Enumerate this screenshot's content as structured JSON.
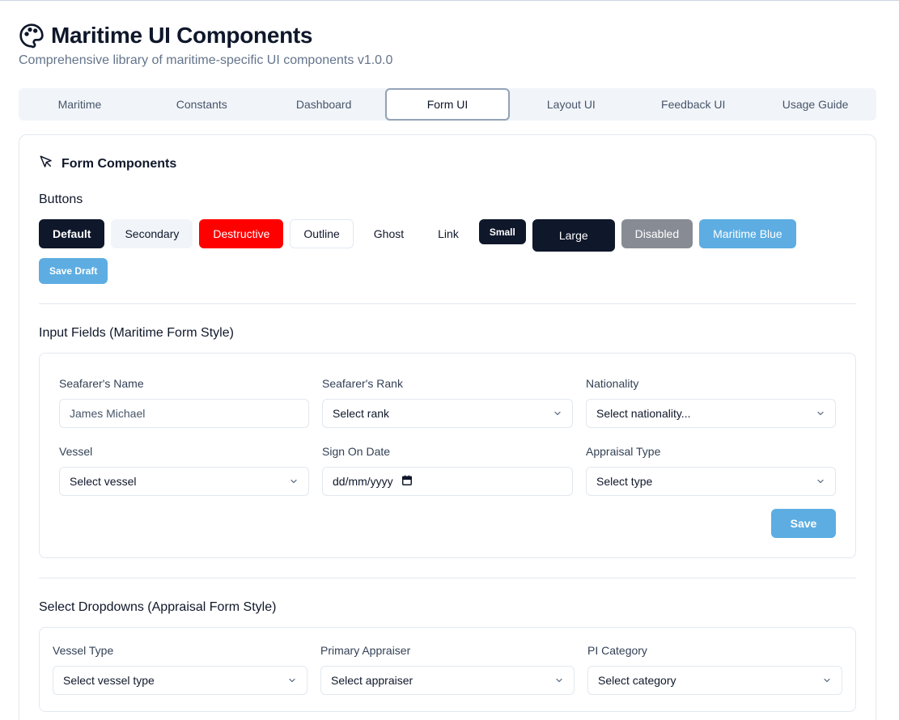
{
  "header": {
    "title": "Maritime UI Components",
    "subtitle": "Comprehensive library of maritime-specific UI components v1.0.0"
  },
  "tabs": [
    {
      "label": "Maritime"
    },
    {
      "label": "Constants"
    },
    {
      "label": "Dashboard"
    },
    {
      "label": "Form UI",
      "active": true
    },
    {
      "label": "Layout UI"
    },
    {
      "label": "Feedback UI"
    },
    {
      "label": "Usage Guide"
    }
  ],
  "card": {
    "title": "Form Components",
    "buttons_heading": "Buttons",
    "buttons": {
      "default": "Default",
      "secondary": "Secondary",
      "destructive": "Destructive",
      "outline": "Outline",
      "ghost": "Ghost",
      "link": "Link",
      "small": "Small",
      "large": "Large",
      "disabled": "Disabled",
      "maritime": "Maritime Blue",
      "save_draft": "Save Draft"
    },
    "inputs_heading": "Input Fields (Maritime Form Style)",
    "inputs": {
      "name_label": "Seafarer's Name",
      "name_placeholder": "James Michael",
      "rank_label": "Seafarer's Rank",
      "rank_value": "Select rank",
      "nationality_label": "Nationality",
      "nationality_value": "Select nationality...",
      "vessel_label": "Vessel",
      "vessel_value": "Select vessel",
      "signon_label": "Sign On Date",
      "signon_value": "dd/mm/yyyy",
      "appraisal_label": "Appraisal Type",
      "appraisal_value": "Select type",
      "save": "Save"
    },
    "selects_heading": "Select Dropdowns (Appraisal Form Style)",
    "selects": {
      "vessel_type_label": "Vessel Type",
      "vessel_type_value": "Select vessel type",
      "appraiser_label": "Primary Appraiser",
      "appraiser_value": "Select appraiser",
      "pi_label": "PI Category",
      "pi_value": "Select category"
    }
  },
  "colors": {
    "primary": "#0f172a",
    "destructive": "#ff0000",
    "maritime_blue": "#5dade2",
    "disabled": "#878c94"
  }
}
